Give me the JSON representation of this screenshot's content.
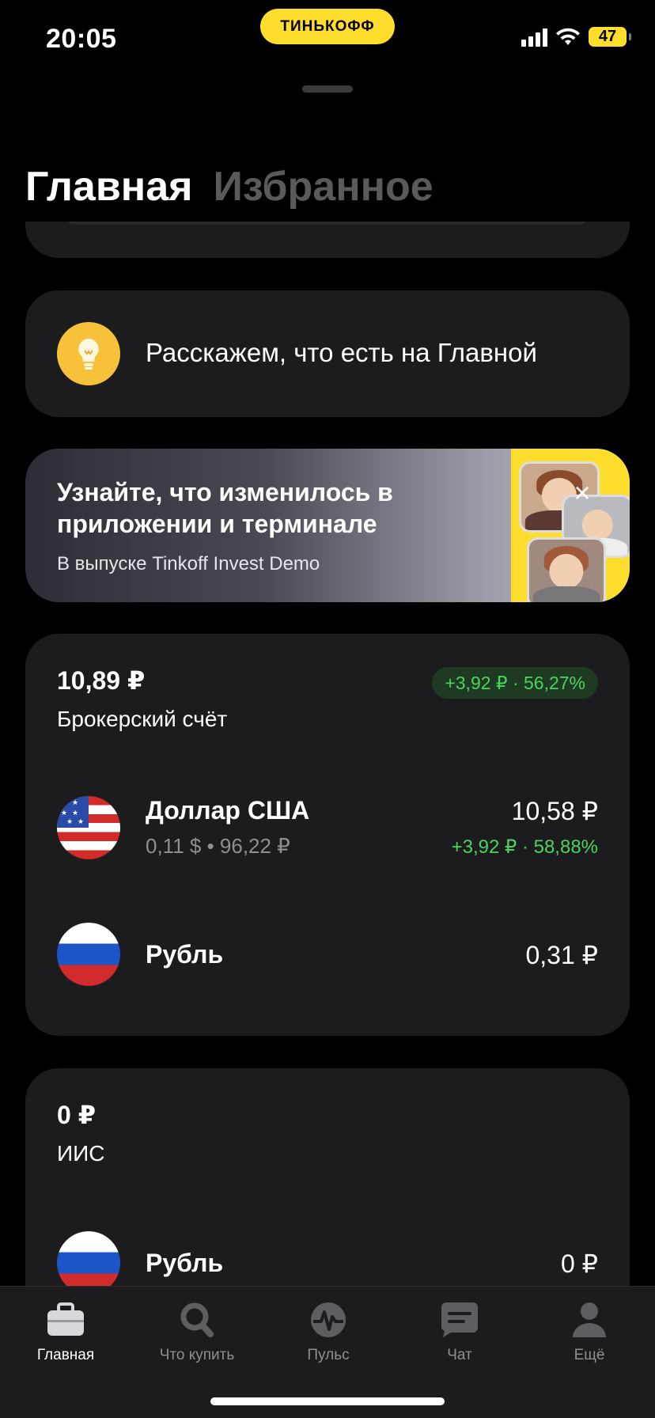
{
  "status": {
    "time": "20:05",
    "brand": "ТИНЬКОФФ",
    "battery": "47"
  },
  "header": {
    "tabs": [
      {
        "label": "Главная",
        "active": true
      },
      {
        "label": "Избранное",
        "active": false
      }
    ]
  },
  "tip": {
    "text": "Расскажем, что есть на Главной",
    "icon": "lightbulb-icon"
  },
  "promo": {
    "title": "Узнайте, что изменилось в приложении и терминале",
    "subtitle": "В выпуске Tinkoff Invest Demo",
    "close_icon": "close-icon"
  },
  "accounts": [
    {
      "amount": "10,89 ₽",
      "name": "Брокерский счёт",
      "change": "+3,92 ₽ · 56,27%",
      "positions": [
        {
          "title": "Доллар США",
          "sub": "0,11 $ • 96,22 ₽",
          "value": "10,58 ₽",
          "change": "+3,92 ₽ · 58,88%",
          "flag": "us-flag"
        },
        {
          "title": "Рубль",
          "sub": "",
          "value": "0,31 ₽",
          "change": "",
          "flag": "ru-flag"
        }
      ]
    },
    {
      "amount": "0 ₽",
      "name": "ИИС",
      "positions": [
        {
          "title": "Рубль",
          "value": "0 ₽",
          "flag": "ru-flag"
        }
      ]
    }
  ],
  "tabbar": [
    {
      "label": "Главная",
      "icon": "briefcase-icon",
      "active": true
    },
    {
      "label": "Что купить",
      "icon": "search-icon",
      "active": false
    },
    {
      "label": "Пульс",
      "icon": "pulse-icon",
      "active": false
    },
    {
      "label": "Чат",
      "icon": "chat-icon",
      "active": false
    },
    {
      "label": "Ещё",
      "icon": "profile-icon",
      "active": false
    }
  ],
  "colors": {
    "accent": "#ffdd2d",
    "positive": "#4cd35c",
    "card": "#1c1c1e",
    "background": "#000000"
  }
}
